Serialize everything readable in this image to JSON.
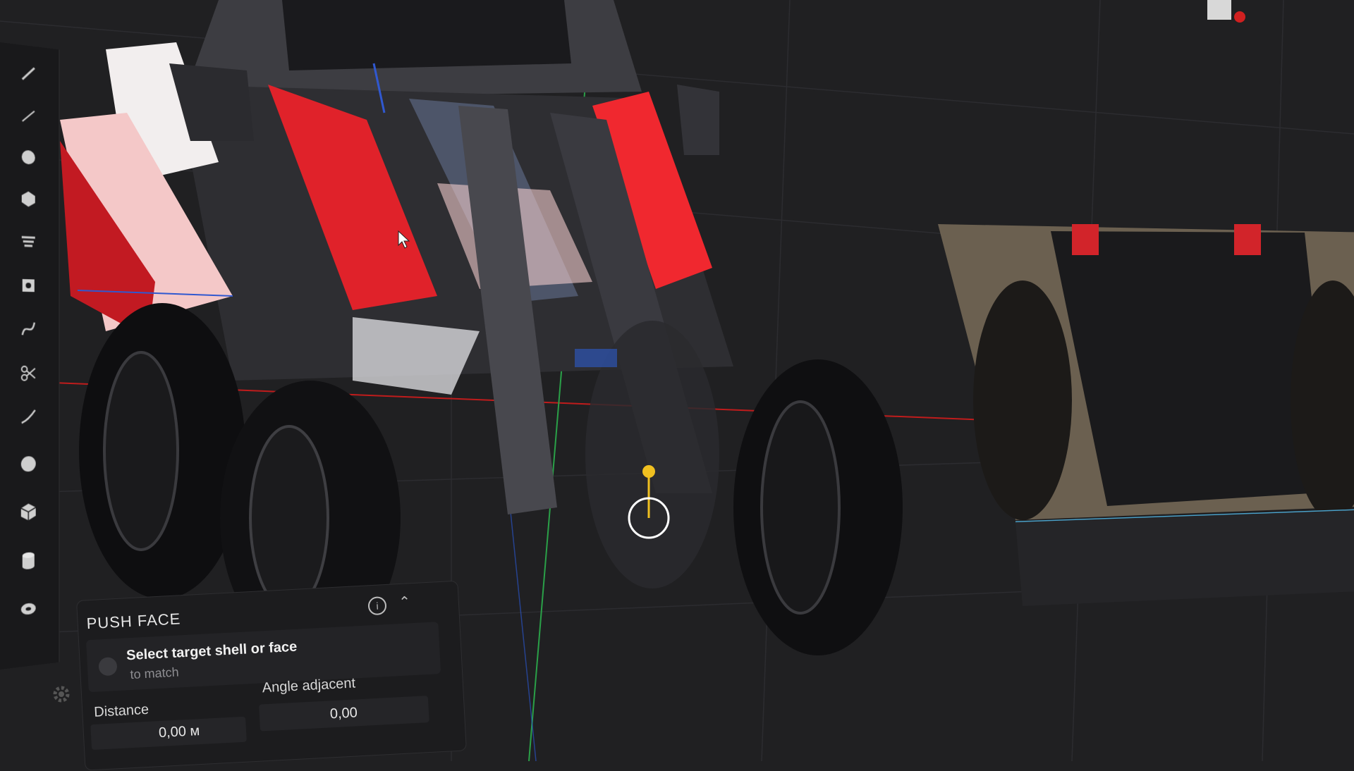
{
  "push_face": {
    "title": "PUSH FACE",
    "info_icon": "info-icon",
    "collapse_icon": "chevron-up-icon",
    "target_label": "Select target shell or face",
    "target_sub": "to match",
    "distance_label": "Distance",
    "distance_value": "0,00 м",
    "angle_label": "Angle adjacent",
    "angle_value": "0,00"
  },
  "toolbar": {
    "tools": [
      "pencil-icon",
      "line-icon",
      "circle-icon",
      "hexagon-icon",
      "layers-icon",
      "square-icon",
      "curve-icon",
      "scissors-icon",
      "spline-icon",
      "sphere-icon",
      "cube-icon",
      "cylinder-icon",
      "torus-icon"
    ],
    "settings_icon": "gear-icon"
  },
  "colors": {
    "background": "#202022",
    "panel": "#1c1c1e",
    "accent_red": "#e0222a",
    "axis_x": "#d02020",
    "axis_y": "#2aa048",
    "axis_z": "#2a5ad8",
    "gizmo": "#f0c020"
  }
}
